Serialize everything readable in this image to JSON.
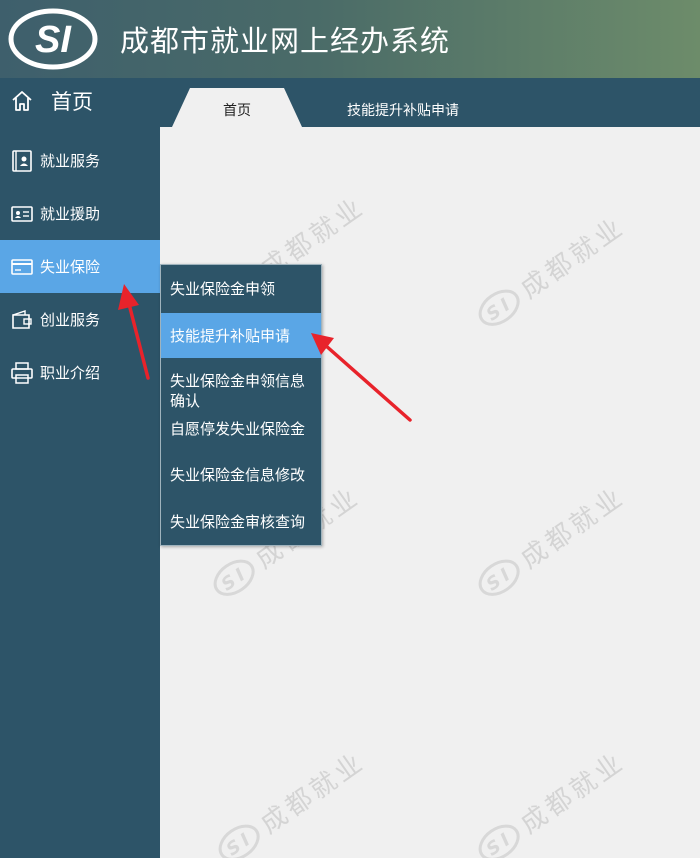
{
  "header": {
    "title": "成都市就业网上经办系统",
    "logo_text": "SI"
  },
  "nav": {
    "home_label": "首页",
    "tabs": [
      {
        "label": "首页",
        "active": true
      },
      {
        "label": "技能提升补贴申请",
        "active": false
      }
    ]
  },
  "sidebar": {
    "items": [
      {
        "label": "就业服务",
        "icon": "id-card-icon"
      },
      {
        "label": "就业援助",
        "icon": "badge-card-icon"
      },
      {
        "label": "失业保险",
        "icon": "card-icon",
        "active": true
      },
      {
        "label": "创业服务",
        "icon": "wallet-icon"
      },
      {
        "label": "职业介绍",
        "icon": "printer-icon"
      }
    ]
  },
  "dropdown": {
    "items": [
      {
        "label": "失业保险金申领"
      },
      {
        "label": "技能提升补贴申请",
        "active": true
      },
      {
        "label": "失业保险金申领信息确认"
      },
      {
        "label": "自愿停发失业保险金"
      },
      {
        "label": "失业保险金信息修改"
      },
      {
        "label": "失业保险金审核查询"
      }
    ]
  },
  "watermark": {
    "text": "成都就业"
  },
  "colors": {
    "sidebar_bg": "#2d5468",
    "active_bg": "#5aa6e6",
    "content_bg": "#f0f0f0",
    "annotation_arrow": "#e8232b"
  }
}
